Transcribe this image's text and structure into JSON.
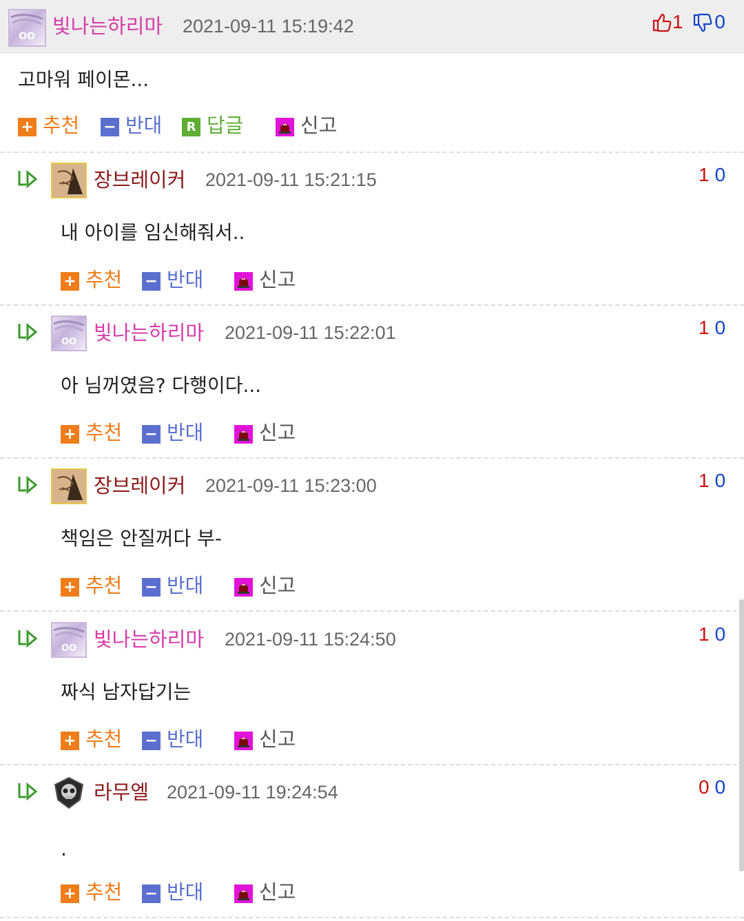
{
  "colors": {
    "nick_pink": "#d63ba8",
    "nick_maroon": "#8b1a1a",
    "recommend": "#ef7d1a",
    "oppose": "#5b6fcf",
    "reply": "#5fae33",
    "report": "#e213d8",
    "vote_up": "#cc1111",
    "vote_down": "#1144cc"
  },
  "labels": {
    "recommend": "추천",
    "oppose": "반대",
    "reply": "답글",
    "report": "신고"
  },
  "top_comment": {
    "nick": "빛나는하리마",
    "time": "2021-09-11 15:19:42",
    "text": "고마워 페이몬...",
    "up": "1",
    "down": "0"
  },
  "replies": [
    {
      "nick": "장브레이커",
      "time": "2021-09-11 15:21:15",
      "text": "내 아이를 임신해줘서..",
      "up": "1",
      "down": "0"
    },
    {
      "nick": "빛나는하리마",
      "time": "2021-09-11 15:22:01",
      "text": "아 님꺼였음? 다행이다...",
      "up": "1",
      "down": "0"
    },
    {
      "nick": "장브레이커",
      "time": "2021-09-11 15:23:00",
      "text": "책임은 안질꺼다 부-",
      "up": "1",
      "down": "0"
    },
    {
      "nick": "빛나는하리마",
      "time": "2021-09-11 15:24:50",
      "text": "짜식 남자답기는",
      "up": "1",
      "down": "0"
    },
    {
      "nick": "라무엘",
      "time": "2021-09-11 19:24:54",
      "text": ".",
      "up": "0",
      "down": "0"
    }
  ]
}
